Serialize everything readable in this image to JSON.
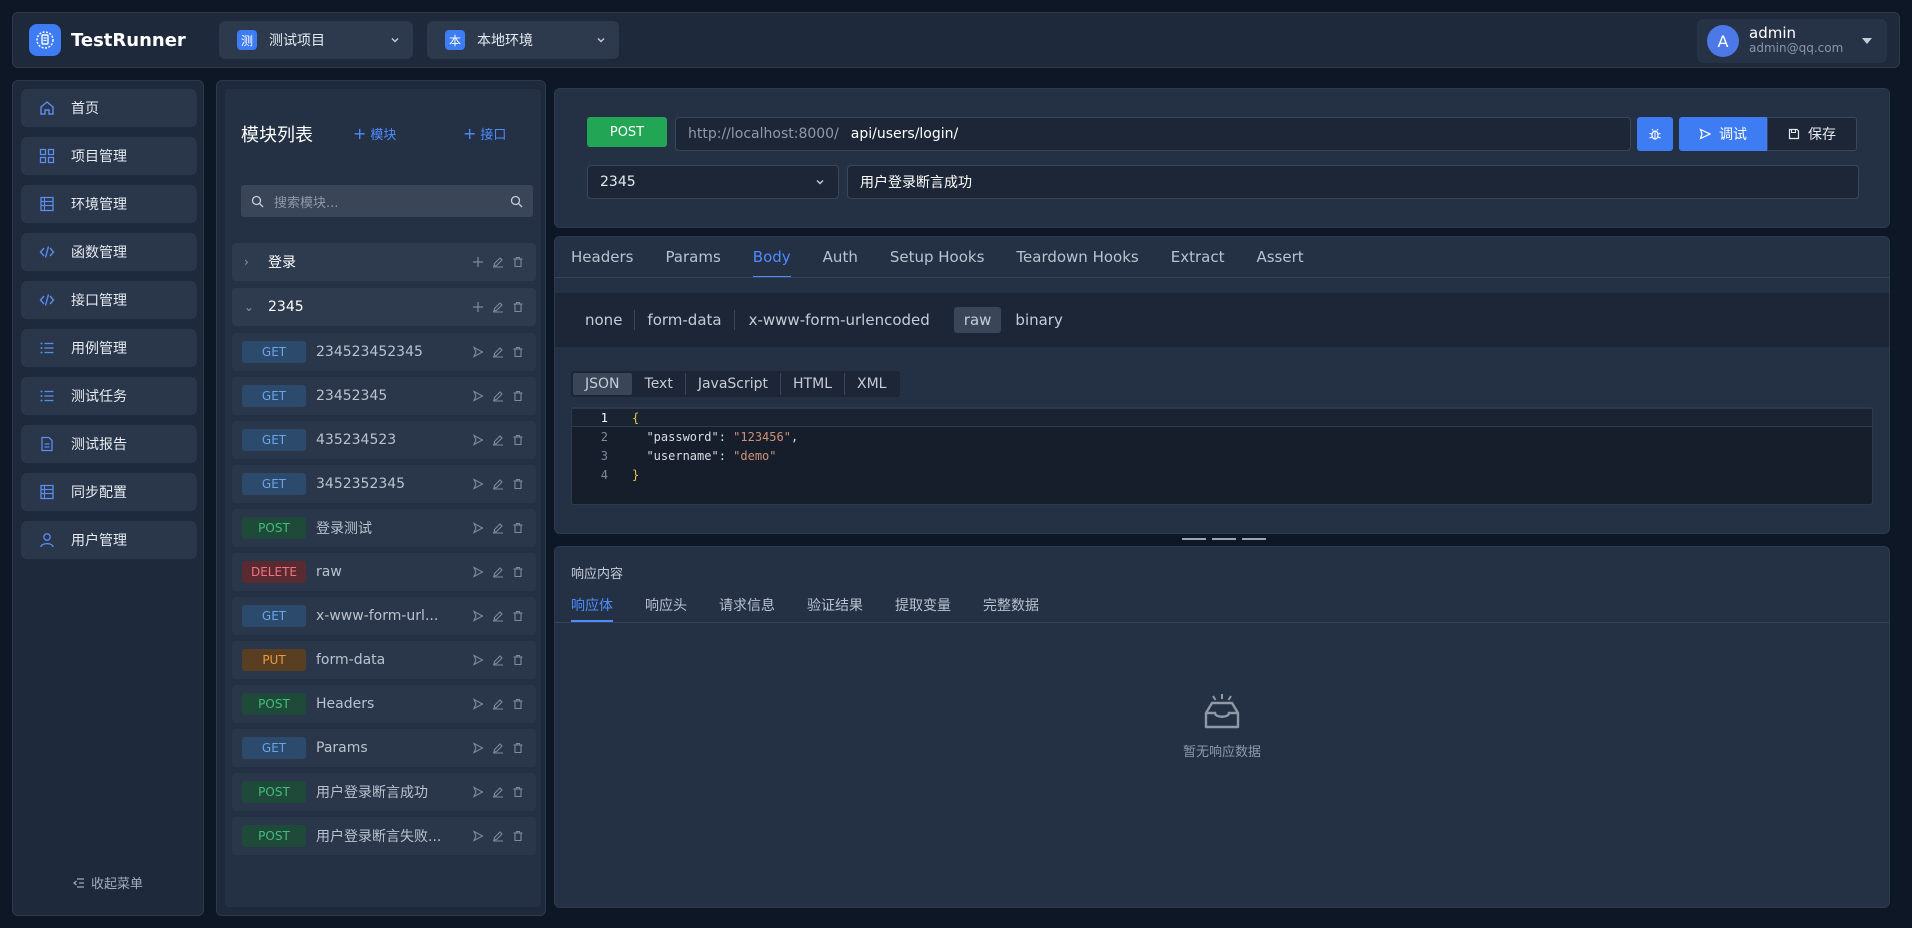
{
  "app": {
    "name": "TestRunner"
  },
  "header": {
    "project": {
      "badge": "测",
      "label": "测试项目"
    },
    "env": {
      "badge": "本",
      "label": "本地环境"
    },
    "user": {
      "initial": "A",
      "name": "admin",
      "email": "admin@qq.com"
    }
  },
  "sidebar": {
    "items": [
      {
        "label": "首页",
        "icon": "home-icon"
      },
      {
        "label": "项目管理",
        "icon": "grid-icon"
      },
      {
        "label": "环境管理",
        "icon": "table-icon"
      },
      {
        "label": "函数管理",
        "icon": "code-icon"
      },
      {
        "label": "接口管理",
        "icon": "code-icon"
      },
      {
        "label": "用例管理",
        "icon": "list-icon"
      },
      {
        "label": "测试任务",
        "icon": "list-icon"
      },
      {
        "label": "测试报告",
        "icon": "document-icon"
      },
      {
        "label": "同步配置",
        "icon": "table-icon"
      },
      {
        "label": "用户管理",
        "icon": "user-icon"
      }
    ],
    "collapse_label": "收起菜单"
  },
  "modules": {
    "title": "模块列表",
    "add_module": "模块",
    "add_api": "接口",
    "search_placeholder": "搜索模块...",
    "folders": [
      {
        "name": "登录",
        "expanded": false
      },
      {
        "name": "2345",
        "expanded": true
      }
    ],
    "apis": [
      {
        "method": "GET",
        "name": "234523452345"
      },
      {
        "method": "GET",
        "name": "23452345"
      },
      {
        "method": "GET",
        "name": "435234523"
      },
      {
        "method": "GET",
        "name": "3452352345"
      },
      {
        "method": "POST",
        "name": "登录测试"
      },
      {
        "method": "DELETE",
        "name": "raw"
      },
      {
        "method": "GET",
        "name": "x-www-form-url..."
      },
      {
        "method": "PUT",
        "name": "form-data"
      },
      {
        "method": "POST",
        "name": "Headers"
      },
      {
        "method": "GET",
        "name": "Params"
      },
      {
        "method": "POST",
        "name": "用户登录断言成功"
      },
      {
        "method": "POST",
        "name": "用户登录断言失败..."
      }
    ]
  },
  "request": {
    "method": "POST",
    "base_url": "http://localhost:8000/",
    "path": "api/users/login/",
    "debug_label": "调试",
    "save_label": "保存",
    "module": "2345",
    "name": "用户登录断言成功"
  },
  "tabs": [
    "Headers",
    "Params",
    "Body",
    "Auth",
    "Setup Hooks",
    "Teardown Hooks",
    "Extract",
    "Assert"
  ],
  "active_tab": "Body",
  "body_types": [
    "none",
    "form-data",
    "x-www-form-urlencoded",
    "raw",
    "binary"
  ],
  "active_body_type": "raw",
  "raw_langs": [
    "JSON",
    "Text",
    "JavaScript",
    "HTML",
    "XML"
  ],
  "active_lang": "JSON",
  "code": {
    "line_numbers": [
      "1",
      "2",
      "3",
      "4"
    ],
    "open": "{",
    "password_key": "\"password\"",
    "password_val": "\"123456\"",
    "username_key": "\"username\"",
    "username_val": "\"demo\"",
    "close": "}"
  },
  "response": {
    "title": "响应内容",
    "tabs": [
      "响应体",
      "响应头",
      "请求信息",
      "验证结果",
      "提取变量",
      "完整数据"
    ],
    "active_tab": "响应体",
    "empty_text": "暂无响应数据"
  },
  "colors": {
    "accent": "#3d7cf2",
    "get": "#6aa3e8",
    "post": "#3ec07a",
    "delete": "#f07382",
    "put": "#ee9a40"
  }
}
